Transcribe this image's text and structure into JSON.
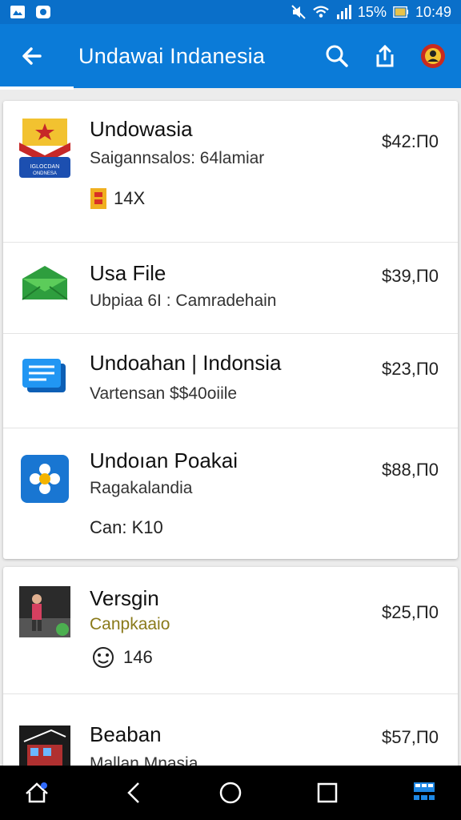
{
  "status_bar": {
    "battery": "15%",
    "time": "10:49"
  },
  "app_bar": {
    "title": "Undawai Indanesia"
  },
  "items": [
    {
      "name": "Undowasia",
      "subtitle": "Saigannsalos: 64lamiar",
      "meta": "14X",
      "price": "$42:Π0"
    },
    {
      "name": "Usa File",
      "subtitle": "Ubpiaa 6I : Camradehain",
      "price": "$39,Π0"
    },
    {
      "name": "Undoahan | Indonsia",
      "subtitle": "Vartensan $$40oiile",
      "price": "$23,Π0"
    },
    {
      "name": "Undoıan Poakai",
      "subtitle": "Ragakalandia",
      "meta": "Can: K10",
      "price": "$88,Π0"
    },
    {
      "name": "Versgin",
      "subtitle": "Canpkaaio",
      "meta": "146",
      "price": "$25,Π0"
    },
    {
      "name": "Beaban",
      "subtitle": "Mallan Mnasia",
      "price": "$57,Π0"
    }
  ],
  "colors": {
    "app_bar": "#0b7bd8",
    "status_bar": "#0a6fc9"
  }
}
